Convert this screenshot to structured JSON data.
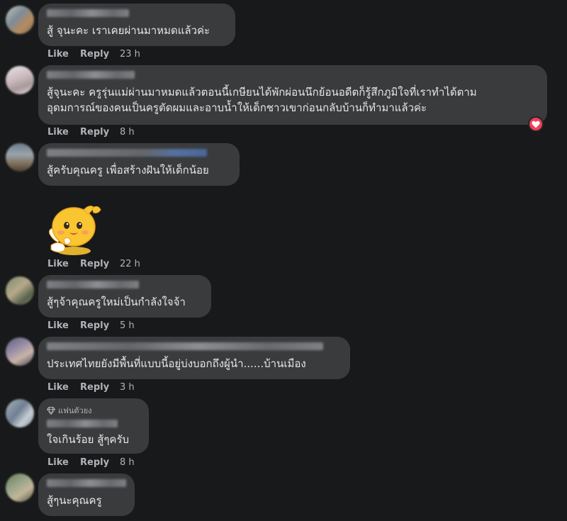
{
  "comments": [
    {
      "text": "สู้ จุนะคะ เราเคยผ่านมาหมดแล้วค่ะ",
      "like": "Like",
      "reply": "Reply",
      "time": "23 h"
    },
    {
      "text_line1": "สู้จุนะคะ ครูรุ่นแม่ผ่านมาหมดแล้วตอนนี้เกษียนได้พักผ่อนนึกย้อนอดีตก็รู้สึกภูมิใจที่เราทำได้ตาม",
      "text_line2": "อุดมการณ์ของคนเป็นครูตัดผมและอาบน้ำให้เด็กชาวเขาก่อนกลับบ้านก็ทำมาแล้วค่ะ",
      "like": "Like",
      "reply": "Reply",
      "time": "8 h",
      "reaction": "love-icon"
    },
    {
      "text": "สู้ครับคุณครู เพื่อสร้างฝันให้เด็กน้อย",
      "like": "Like",
      "reply": "Reply",
      "time": ""
    },
    {
      "sticker": "sticker-icon",
      "like": "Like",
      "reply": "Reply",
      "time": "22 h"
    },
    {
      "text": "สู้ๆจ้าคุณครูใหม่เป็นกำลังใจจ้า",
      "like": "Like",
      "reply": "Reply",
      "time": "5 h"
    },
    {
      "text": "ประเทศไทยยังมีพื้นที่แบบนี้อยู่บ่งบอกถึงผู้นำ......บ้านเมือง",
      "like": "Like",
      "reply": "Reply",
      "time": "3 h"
    },
    {
      "badge": "แฟนตัวยง",
      "text": "ใจเกินร้อย สู้ๆครับ",
      "like": "Like",
      "reply": "Reply",
      "time": "8 h"
    },
    {
      "text": "สู้ๆนะคุณครู"
    }
  ],
  "colors": {
    "background": "#18191a",
    "bubble": "#3a3b3c",
    "text": "#e4e6eb",
    "meta": "#b0b3b8",
    "love": "#f33e58"
  }
}
